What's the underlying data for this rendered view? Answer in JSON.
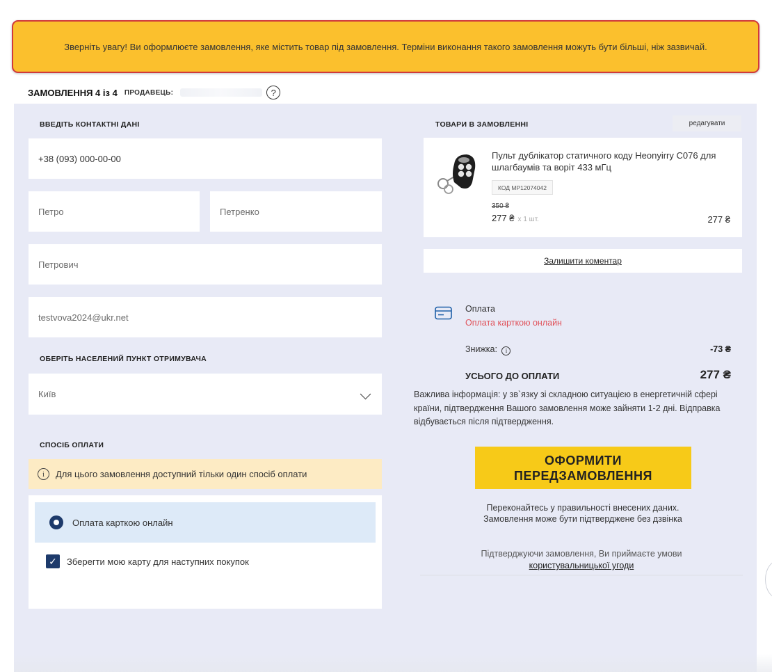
{
  "notice": {
    "text": "Зверніть увагу! Ви оформлюєте замовлення, яке містить товар під замовлення. Терміни виконання такого замовлення можуть бути більші, ніж зазвичай."
  },
  "order_tab": {
    "order_label": "ЗАМОВЛЕННЯ 4 із 4",
    "seller_label": "ПРОДАВЕЦЬ:",
    "help_glyph": "?"
  },
  "contact": {
    "title": "ВВЕДІТЬ КОНТАКТНІ ДАНІ",
    "phone": "+38 (093) 000-00-00",
    "first_name": "Петро",
    "last_name": "Петренко",
    "middle_name": "Петрович",
    "email": "testvova2024@ukr.net"
  },
  "city": {
    "title": "ОБЕРІТЬ НАСЕЛЕНИЙ ПУНКТ ОТРИМУВАЧА",
    "selected": "Київ"
  },
  "payment": {
    "title": "СПОСІБ ОПЛАТИ",
    "info_glyph": "i",
    "info": "Для цього замовлення доступний тільки один спосіб оплати",
    "option": "Оплата карткою онлайн",
    "save_card": "Зберегти мою карту для наступних покупок",
    "save_card_checked": true
  },
  "order_items": {
    "title": "ТОВАРИ В ЗАМОВЛЕННІ",
    "edit_label": "редагувати",
    "product": {
      "name": "Пульт дублікатор статичного коду Heonyirry C076 для шлагбаумів та воріт 433 мГц",
      "code": "КОД MP12074042",
      "old_price": "350 ₴",
      "price": "277 ₴",
      "qty": "x 1 шт.",
      "total": "277 ₴"
    },
    "comment_link": "Залишити коментар"
  },
  "summary": {
    "payment_label": "Оплата",
    "payment_value": "Оплата карткою онлайн",
    "discount_label": "Знижка:",
    "discount_info_glyph": "i",
    "discount_value": "-73 ₴",
    "total_label": "УСЬОГО ДО ОПЛАТИ",
    "total_value": "277 ₴",
    "important": "Важлива інформація: у зв`язку зі складною ситуацією в енергетичній сфері країни, підтвердження Вашого замовлення може зайняти 1-2 дні. Відправка відбувається після підтвердження.",
    "submit_line1": "ОФОРМИТИ",
    "submit_line2": "ПЕРЕДЗАМОВЛЕННЯ",
    "verify_line1": "Переконайтесь у правильності внесених даних.",
    "verify_line2": "Замовлення може бути підтверджене без дзвінка",
    "terms_text": "Підтверджуючи замовлення, Ви приймаєте умови",
    "terms_link": "користувальницької угоди"
  },
  "colors": {
    "notice_bg": "#fbc02d",
    "notice_border": "#d0393b",
    "panel_bg": "#e8eaf6",
    "accent_navy": "#1d3a6b",
    "submit_bg": "#f7ca18",
    "payment_red": "#e0525a"
  }
}
